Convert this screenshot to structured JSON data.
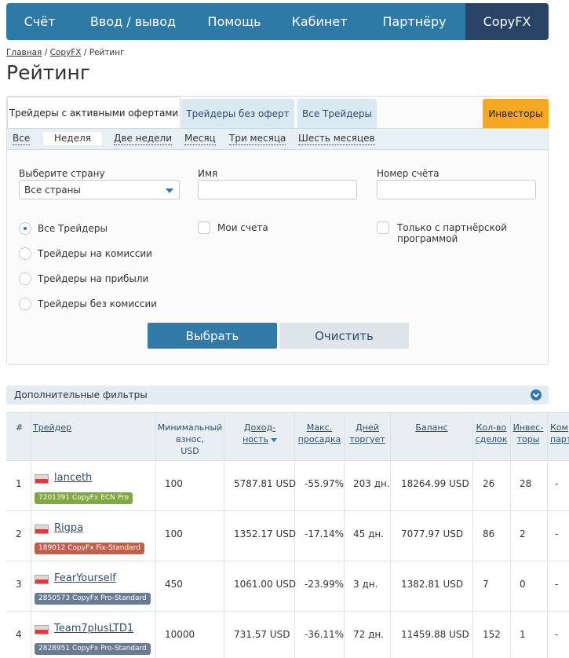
{
  "nav": {
    "items": [
      "Счёт",
      "Ввод / вывод",
      "Помощь",
      "Кабинет",
      "Партнёру",
      "CopyFX"
    ],
    "active_color": "#2a4467",
    "bar_color": "#2d7aa6"
  },
  "breadcrumb": {
    "home": "Главная",
    "sep1": "/",
    "section": "CopyFX",
    "sep2": "/",
    "current": "Рейтинг"
  },
  "page_title": "Рейтинг",
  "tabs": {
    "active": "Трейдеры с активными офертами",
    "no_offers": "Трейдеры без оферт",
    "all": "Все Трейдеры",
    "investors": "Инвесторы",
    "investors_color": "#f6a821"
  },
  "periods": [
    "Все",
    "Неделя",
    "Две недели",
    "Месяц",
    "Три месяца",
    "Шесть месяцев"
  ],
  "filters": {
    "country_label": "Выберите страну",
    "country_value": "Все страны",
    "name_label": "Имя",
    "account_label": "Номер счёта",
    "radios": [
      "Все Трейдеры",
      "Трейдеры на комиссии",
      "Трейдеры на прибыли",
      "Трейдеры без комиссии"
    ],
    "my_accounts": "Мои счета",
    "partner_line1": "Только с партнёрской",
    "partner_line2": "программой",
    "submit": "Выбрать",
    "clear": "Очистить"
  },
  "extra_filters": "Дополнительные фильтры",
  "table": {
    "headers": {
      "num": "#",
      "trader": "Трейдер",
      "min1": "Минимальный",
      "min2": "взнос,",
      "min3": "USD",
      "profit1": "Доход-",
      "profit2": "ность",
      "dd1": "Макс.",
      "dd2": "просадка",
      "days1": "Дней",
      "days2": "торгует",
      "balance": "Баланс",
      "deals1": "Кол-во",
      "deals2": "сделок",
      "inv1": "Инвес-",
      "inv2": "торы",
      "comm1": "Ком",
      "comm2": "парт"
    },
    "rows": [
      {
        "n": "1",
        "name": "lanceth",
        "account": "7201391 CopyFx ECN Pro",
        "badge_color": "#7fa83e",
        "min": "100",
        "profit": "5787.81 USD",
        "dd": "-55.97%",
        "days": "203 дн.",
        "balance": "18264.99 USD",
        "deals": "26",
        "investors": "28",
        "comm": "-"
      },
      {
        "n": "2",
        "name": "Rigpa",
        "account": "189012 CopyFx Fix-Standard",
        "badge_color": "#c0604c",
        "min": "100",
        "profit": "1352.17 USD",
        "dd": "-17.14%",
        "days": "45 дн.",
        "balance": "7077.97 USD",
        "deals": "86",
        "investors": "2",
        "comm": "-"
      },
      {
        "n": "3",
        "name": "FearYourself",
        "account": "2850573 CopyFx Pro-Standard",
        "badge_color": "#6a7b94",
        "min": "450",
        "profit": "1061.00 USD",
        "dd": "-23.99%",
        "days": "3 дн.",
        "balance": "1382.81 USD",
        "deals": "7",
        "investors": "0",
        "comm": "-"
      },
      {
        "n": "4",
        "name": "Team7plusLTD1",
        "account": "2828951 CopyFx Pro-Standard",
        "badge_color": "#6a7b94",
        "min": "10000",
        "profit": "731.57 USD",
        "dd": "-36.11%",
        "days": "72 дн.",
        "balance": "11459.88 USD",
        "deals": "152",
        "investors": "1",
        "comm": "-"
      }
    ]
  }
}
